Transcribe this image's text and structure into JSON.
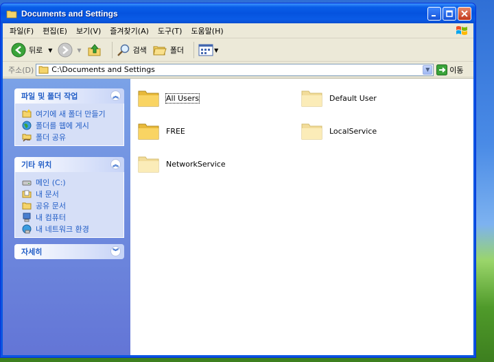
{
  "window": {
    "title": "Documents and Settings"
  },
  "menu": [
    "파일(F)",
    "편집(E)",
    "보기(V)",
    "즐겨찾기(A)",
    "도구(T)",
    "도움말(H)"
  ],
  "toolbar": {
    "back_label": "뒤로",
    "search_label": "검색",
    "folders_label": "폴더"
  },
  "address": {
    "label": "주소(D)",
    "value": "C:\\Documents and Settings",
    "go_label": "이동"
  },
  "taskpane": {
    "file_tasks": {
      "title": "파일 및 폴더 작업",
      "items": [
        {
          "label": "여기에 새 폴더 만들기",
          "icon": "new-folder-icon"
        },
        {
          "label": "폴더를 웹에 게시",
          "icon": "publish-web-icon"
        },
        {
          "label": "폴더 공유",
          "icon": "share-folder-icon"
        }
      ]
    },
    "other_places": {
      "title": "기타 위치",
      "items": [
        {
          "label": "메인 (C:)",
          "icon": "drive-icon"
        },
        {
          "label": "내 문서",
          "icon": "my-documents-icon"
        },
        {
          "label": "공유 문서",
          "icon": "shared-documents-icon"
        },
        {
          "label": "내 컴퓨터",
          "icon": "my-computer-icon"
        },
        {
          "label": "내 네트워크 환경",
          "icon": "network-places-icon"
        }
      ]
    },
    "details": {
      "title": "자세히"
    }
  },
  "folders": [
    {
      "name": "All Users"
    },
    {
      "name": "Default User"
    },
    {
      "name": "FREE"
    },
    {
      "name": "LocalService"
    },
    {
      "name": "NetworkService"
    }
  ],
  "colors": {
    "titlebar": "#0a55e2",
    "taskpane_text": "#215dc6",
    "folder_yellow": "#f5d46b"
  }
}
